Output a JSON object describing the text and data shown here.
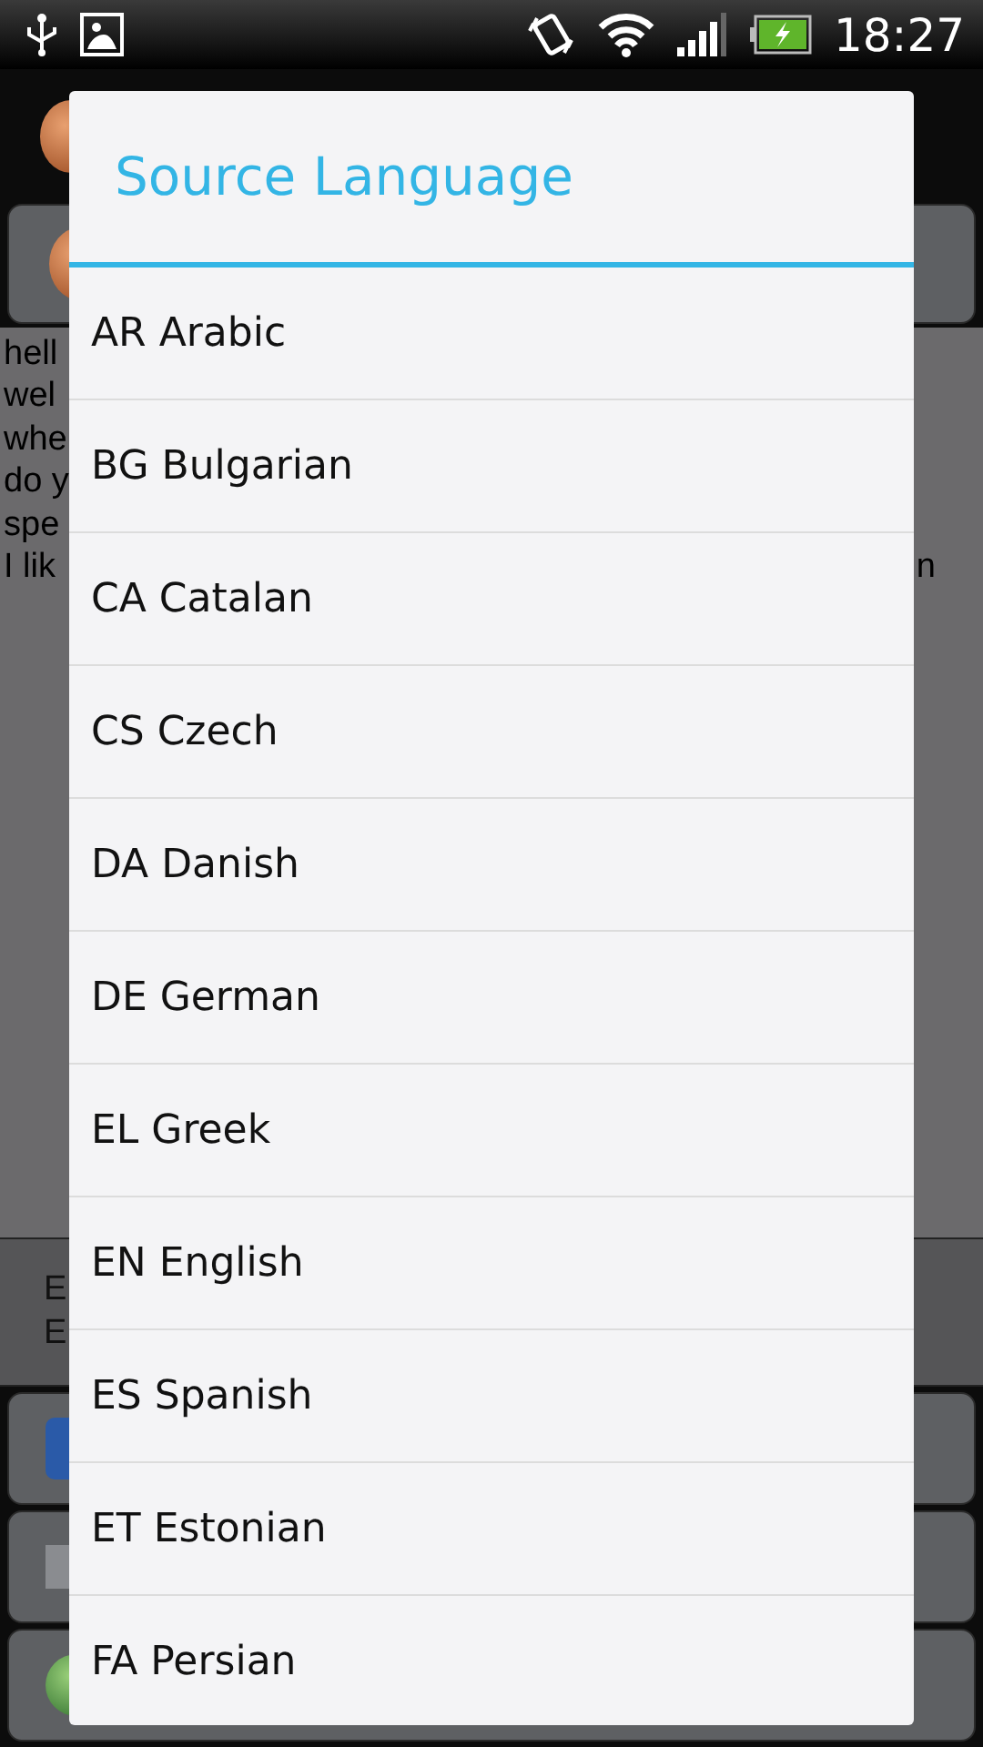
{
  "status_bar": {
    "time": "18:27"
  },
  "background": {
    "text_lines": [
      {
        "text": "hell"
      },
      {
        "text": "wel"
      },
      {
        "text": "whe"
      },
      {
        "text": "do y"
      },
      {
        "text": "spe"
      },
      {
        "text": "I lik",
        "tail": "n"
      }
    ],
    "lower_lines": [
      "E",
      "E"
    ]
  },
  "dialog": {
    "title": "Source Language",
    "items": [
      {
        "label": "AR Arabic"
      },
      {
        "label": "BG Bulgarian"
      },
      {
        "label": "CA Catalan"
      },
      {
        "label": "CS Czech"
      },
      {
        "label": "DA Danish"
      },
      {
        "label": "DE German"
      },
      {
        "label": "EL Greek"
      },
      {
        "label": "EN English"
      },
      {
        "label": "ES Spanish"
      },
      {
        "label": "ET Estonian"
      },
      {
        "label": "FA Persian"
      }
    ]
  }
}
